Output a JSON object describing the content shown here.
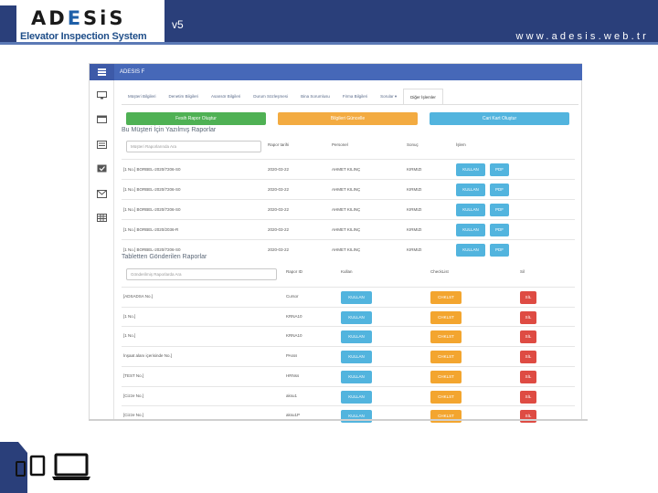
{
  "slide": {
    "logo_part1": "AD",
    "logo_part2": "E",
    "logo_part3": "SiS",
    "tagline": "Elevator Inspection System",
    "version": "v5",
    "website": "www.adesis.web.tr"
  },
  "app": {
    "topbar_title": "ADESIS F",
    "tabs": [
      {
        "label": "Müşteri Bilgileri"
      },
      {
        "label": "Denetim Bilgileri"
      },
      {
        "label": "Asansör Bilgileri"
      },
      {
        "label": "Durum Sözleşmesi"
      },
      {
        "label": "Bina Sorumlusu"
      },
      {
        "label": "Firma Bilgileri"
      },
      {
        "label": "Sorular ▾"
      },
      {
        "label": "Diğer İşlemler"
      }
    ],
    "actions": {
      "create_report": "Fesih Rapor Oluştur",
      "update_data": "Bilgileri Güncelle",
      "create_card": "Cari Kart Oluştur"
    },
    "written_reports": {
      "title": "Bu Müşteri İçin Yazılmış Raporlar",
      "search_placeholder": "Müşteri Raporlarında Ara",
      "headers": [
        "",
        "Rapor tarihi",
        "Personel",
        "Sonuç",
        "İşlem"
      ],
      "rows": [
        {
          "name": "[1 No.] BORBEL-2020/7206-S0",
          "date": "2020-03-22",
          "staff": "AHMET KILINÇ",
          "result": "KIRMIZI"
        },
        {
          "name": "[1 No.] BORBEL-2020/7206-S0",
          "date": "2020-03-22",
          "staff": "AHMET KILINÇ",
          "result": "KIRMIZI"
        },
        {
          "name": "[1 No.] BORBEL-2020/7206-S0",
          "date": "2020-03-22",
          "staff": "AHMET KILINÇ",
          "result": "KIRMIZI"
        },
        {
          "name": "[1 No.] BORBEL-2020/2036-R",
          "date": "2020-03-22",
          "staff": "AHMET KILINÇ",
          "result": "KIRMIZI"
        },
        {
          "name": "[1 No.] BORBEL-2020/7206-S0",
          "date": "2020-03-22",
          "staff": "AHMET KILINÇ",
          "result": "KIRMIZI"
        }
      ],
      "use_label": "KULLAN",
      "pdf_labels": [
        "PDF",
        "PDF",
        "PDF",
        "PDF",
        "PDF"
      ]
    },
    "tablet_reports": {
      "title": "Tabletten Gönderilen Raporlar",
      "search_placeholder": "Gönderilmiş Raporlarda Ara",
      "headers": [
        "",
        "Rapor ID",
        "Kullan",
        "CheckList",
        "Sil"
      ],
      "rows": [
        {
          "name": "[ADSADSA No.]",
          "id": "Cursor"
        },
        {
          "name": "[1 No.]",
          "id": "KRNA10"
        },
        {
          "name": "[1 No.]",
          "id": "KRNA10"
        },
        {
          "name": "İnşaat alanı içerisinde No.]",
          "id": "PAsss"
        },
        {
          "name": "[TEST No.]",
          "id": "HRNss"
        },
        {
          "name": "[Cizze No.]",
          "id": "aksu1"
        },
        {
          "name": "[Cizze No.]",
          "id": "aksu1P"
        }
      ],
      "use_label": "KULLAN",
      "check_label": "CHKLST",
      "delete_label": "SİL"
    }
  }
}
